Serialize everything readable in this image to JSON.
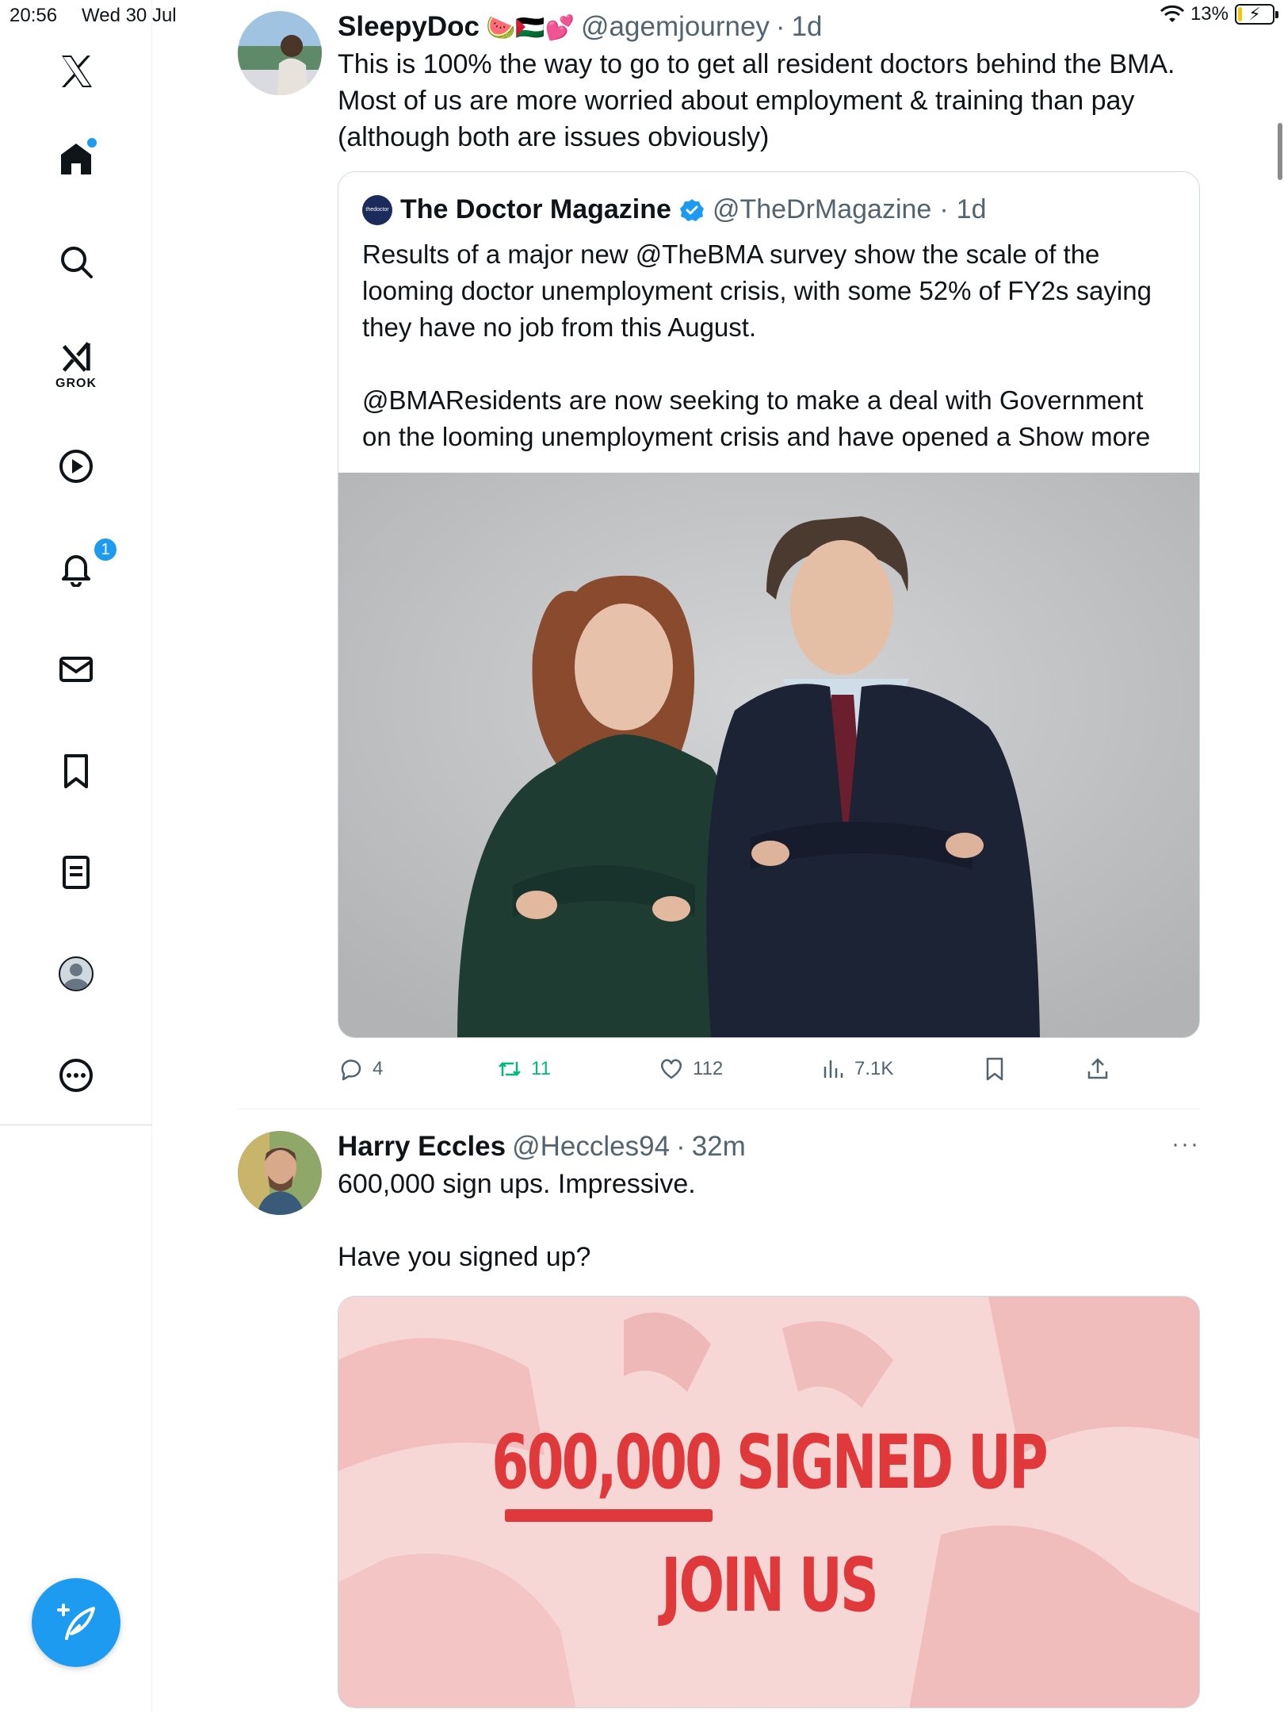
{
  "status_bar": {
    "time": "20:56",
    "date": "Wed 30 Jul",
    "battery_percent": "13%",
    "battery_level": 0.13
  },
  "sidebar": {
    "grok_label": "GROK",
    "notification_count": "1",
    "items": [
      {
        "name": "x-logo",
        "icon": "x-logo-icon"
      },
      {
        "name": "home",
        "icon": "home-icon"
      },
      {
        "name": "explore",
        "icon": "search-icon"
      },
      {
        "name": "grok",
        "icon": "grok-icon"
      },
      {
        "name": "video",
        "icon": "play-icon"
      },
      {
        "name": "notifications",
        "icon": "bell-icon"
      },
      {
        "name": "messages",
        "icon": "envelope-icon"
      },
      {
        "name": "bookmarks",
        "icon": "bookmark-icon"
      },
      {
        "name": "lists",
        "icon": "list-icon"
      },
      {
        "name": "profile",
        "icon": "profile-icon"
      },
      {
        "name": "more",
        "icon": "more-icon"
      }
    ],
    "compose_icon": "compose-icon"
  },
  "colors": {
    "accent": "#1d9bf0",
    "text": "#0f1419",
    "secondary": "#536471",
    "retweet": "#00ba7c",
    "promo_red": "#e0393b"
  },
  "tweets": [
    {
      "name": "SleepyDoc",
      "emojis": "🍉🇵🇸💕",
      "handle": "@agemjourney",
      "dot": "·",
      "time": "1d",
      "text": "This is 100% the way to go to get all resident doctors behind the BMA. Most of us are more worried about employment & training than pay (although both are issues obviously)",
      "quote": {
        "avatar_text": "thedoctor",
        "name": "The Doctor Magazine",
        "handle": "@TheDrMagazine",
        "dot": "·",
        "time": "1d",
        "text": "Results of a major new @TheBMA survey show the scale of the looming doctor unemployment crisis, with some 52% of FY2s saying they have no job from this August.\n\n@BMAResidents are now seeking to make a deal with Government on the looming unemployment crisis and have opened a",
        "show_more": "Show more"
      },
      "actions": {
        "replies": "4",
        "retweets": "11",
        "likes": "112",
        "views": "7.1K"
      }
    },
    {
      "name": "Harry Eccles",
      "handle": "@Heccles94",
      "dot": "·",
      "time": "32m",
      "text": "600,000 sign ups. Impressive.\n\nHave you signed up?",
      "image": {
        "line1": "600,000 SIGNED UP",
        "line2": "JOIN US"
      }
    }
  ]
}
